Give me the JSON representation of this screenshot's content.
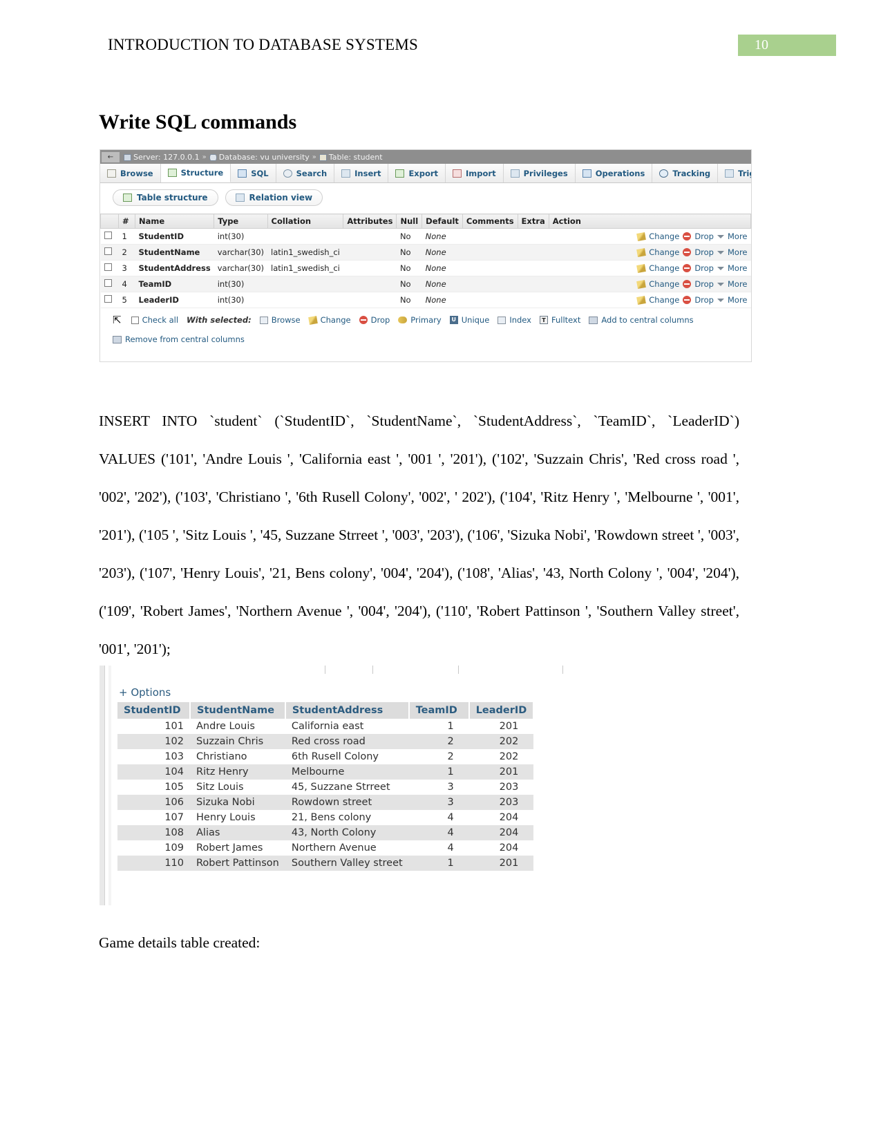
{
  "header": {
    "doc_title": "INTRODUCTION TO DATABASE SYSTEMS",
    "page_number": "10",
    "badge_color": "#a9d08e"
  },
  "main_heading": "Write SQL commands",
  "pma_structure": {
    "breadcrumb": {
      "server_label": "Server: 127.0.0.1",
      "sep1": "»",
      "database_label": "Database: vu university",
      "sep2": "»",
      "table_label": "Table: student",
      "back_arrow": "←"
    },
    "tabs": [
      {
        "label": "Browse",
        "icon": "browse-icon"
      },
      {
        "label": "Structure",
        "icon": "structure-icon"
      },
      {
        "label": "SQL",
        "icon": "sql-icon"
      },
      {
        "label": "Search",
        "icon": "search-icon"
      },
      {
        "label": "Insert",
        "icon": "insert-icon"
      },
      {
        "label": "Export",
        "icon": "export-icon"
      },
      {
        "label": "Import",
        "icon": "import-icon"
      },
      {
        "label": "Privileges",
        "icon": "privileges-icon"
      },
      {
        "label": "Operations",
        "icon": "operations-icon"
      },
      {
        "label": "Tracking",
        "icon": "tracking-icon"
      },
      {
        "label": "Triggers",
        "icon": "triggers-icon"
      }
    ],
    "subtabs": [
      {
        "label": "Table structure",
        "icon": "table-structure-icon"
      },
      {
        "label": "Relation view",
        "icon": "relation-view-icon"
      }
    ],
    "columns": [
      "#",
      "Name",
      "Type",
      "Collation",
      "Attributes",
      "Null",
      "Default",
      "Comments",
      "Extra",
      "Action"
    ],
    "rows": [
      {
        "num": "1",
        "name": "StudentID",
        "type": "int(30)",
        "collation": "",
        "attributes": "",
        "null": "No",
        "default": "None",
        "comments": "",
        "extra": ""
      },
      {
        "num": "2",
        "name": "StudentName",
        "type": "varchar(30)",
        "collation": "latin1_swedish_ci",
        "attributes": "",
        "null": "No",
        "default": "None",
        "comments": "",
        "extra": ""
      },
      {
        "num": "3",
        "name": "StudentAddress",
        "type": "varchar(30)",
        "collation": "latin1_swedish_ci",
        "attributes": "",
        "null": "No",
        "default": "None",
        "comments": "",
        "extra": ""
      },
      {
        "num": "4",
        "name": "TeamID",
        "type": "int(30)",
        "collation": "",
        "attributes": "",
        "null": "No",
        "default": "None",
        "comments": "",
        "extra": ""
      },
      {
        "num": "5",
        "name": "LeaderID",
        "type": "int(30)",
        "collation": "",
        "attributes": "",
        "null": "No",
        "default": "None",
        "comments": "",
        "extra": ""
      }
    ],
    "row_actions": {
      "change": "Change",
      "drop": "Drop",
      "more": "More"
    },
    "footer": {
      "check_all": "Check all",
      "with_selected": "With selected:",
      "browse": "Browse",
      "change": "Change",
      "drop": "Drop",
      "primary": "Primary",
      "unique": "Unique",
      "index": "Index",
      "fulltext": "Fulltext",
      "add_central": "Add to central columns",
      "remove_central": "Remove from central columns"
    }
  },
  "sql_paragraph": "INSERT INTO `student` (`StudentID`, `StudentName`, `StudentAddress`, `TeamID`, `LeaderID`) VALUES ('101', 'Andre Louis ', 'California east ', '001 ', '201'), ('102', 'Suzzain Chris', 'Red cross road ', '002', '202'), ('103', 'Christiano ', '6th Rusell Colony', '002', ' 202'), ('104', 'Ritz Henry ', 'Melbourne ', '001', '201'), ('105 ', 'Sitz Louis ', '45, Suzzane Strreet ', '003', '203'), ('106', 'Sizuka Nobi', 'Rowdown street ', '003', '203'), ('107', 'Henry Louis', '21, Bens colony', '004', '204'), ('108', 'Alias', '43, North Colony ', '004', '204'), ('109', 'Robert James', 'Northern Avenue ', '004', '204'), ('110', 'Robert Pattinson ', 'Southern Valley street', '001', '201');",
  "pma_results": {
    "options_label": "+ Options",
    "columns": [
      "StudentID",
      "StudentName",
      "StudentAddress",
      "TeamID",
      "LeaderID"
    ],
    "rows": [
      {
        "student_id": "101",
        "student_name": "Andre Louis",
        "student_address": "California east",
        "team_id": "1",
        "leader_id": "201"
      },
      {
        "student_id": "102",
        "student_name": "Suzzain Chris",
        "student_address": "Red cross road",
        "team_id": "2",
        "leader_id": "202"
      },
      {
        "student_id": "103",
        "student_name": "Christiano",
        "student_address": "6th Rusell Colony",
        "team_id": "2",
        "leader_id": "202"
      },
      {
        "student_id": "104",
        "student_name": "Ritz Henry",
        "student_address": "Melbourne",
        "team_id": "1",
        "leader_id": "201"
      },
      {
        "student_id": "105",
        "student_name": "Sitz Louis",
        "student_address": "45, Suzzane Strreet",
        "team_id": "3",
        "leader_id": "203"
      },
      {
        "student_id": "106",
        "student_name": "Sizuka Nobi",
        "student_address": "Rowdown street",
        "team_id": "3",
        "leader_id": "203"
      },
      {
        "student_id": "107",
        "student_name": "Henry Louis",
        "student_address": "21, Bens colony",
        "team_id": "4",
        "leader_id": "204"
      },
      {
        "student_id": "108",
        "student_name": "Alias",
        "student_address": "43, North Colony",
        "team_id": "4",
        "leader_id": "204"
      },
      {
        "student_id": "109",
        "student_name": "Robert James",
        "student_address": "Northern Avenue",
        "team_id": "4",
        "leader_id": "204"
      },
      {
        "student_id": "110",
        "student_name": "Robert Pattinson",
        "student_address": "Southern Valley street",
        "team_id": "1",
        "leader_id": "201"
      }
    ]
  },
  "caption": "Game details table created:"
}
